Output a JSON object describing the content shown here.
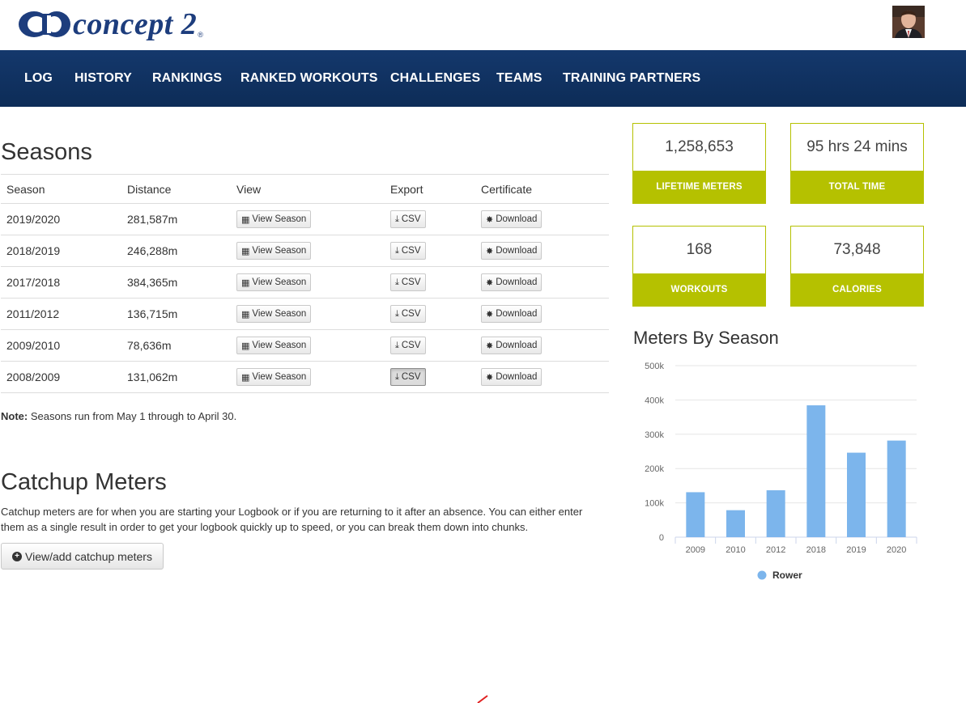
{
  "brand": {
    "name": "concept 2",
    "reg": "®"
  },
  "nav": {
    "items": [
      "LOG",
      "HISTORY",
      "RANKINGS",
      "RANKED WORKOUTS",
      "CHALLENGES",
      "TEAMS",
      "TRAINING PARTNERS"
    ]
  },
  "seasons": {
    "title": "Seasons",
    "columns": [
      "Season",
      "Distance",
      "View",
      "Export",
      "Certificate"
    ],
    "view_label": "View Season",
    "export_label": "CSV",
    "cert_label": "Download",
    "rows": [
      {
        "season": "2019/2020",
        "distance": "281,587m"
      },
      {
        "season": "2018/2019",
        "distance": "246,288m"
      },
      {
        "season": "2017/2018",
        "distance": "384,365m"
      },
      {
        "season": "2011/2012",
        "distance": "136,715m"
      },
      {
        "season": "2009/2010",
        "distance": "78,636m"
      },
      {
        "season": "2008/2009",
        "distance": "131,062m"
      }
    ],
    "note_label": "Note:",
    "note_text": " Seasons run from May 1 through to April 30."
  },
  "catchup": {
    "title": "Catchup Meters",
    "description": "Catchup meters are for when you are starting your Logbook or if you are returning to it after an absence. You can either enter them as a single result in order to get your logbook quickly up to speed, or you can break them down into chunks.",
    "button_label": "View/add catchup meters"
  },
  "stats": {
    "lifetime_meters": {
      "value": "1,258,653",
      "label": "LIFETIME METERS"
    },
    "total_time": {
      "value": "95 hrs 24 mins",
      "label": "TOTAL TIME"
    },
    "workouts": {
      "value": "168",
      "label": "WORKOUTS"
    },
    "calories": {
      "value": "73,848",
      "label": "CALORIES"
    }
  },
  "colors": {
    "accent": "#b5c100",
    "nav": "#14386c",
    "bar": "#7cb5ec",
    "brand": "#1d3d7d"
  },
  "chart_data": {
    "type": "bar",
    "title": "Meters By Season",
    "categories": [
      "2009",
      "2010",
      "2012",
      "2018",
      "2019",
      "2020"
    ],
    "series": [
      {
        "name": "Rower",
        "values": [
          131062,
          78636,
          136715,
          384365,
          246288,
          281587
        ]
      }
    ],
    "ylim": [
      0,
      500000
    ],
    "yticks": [
      "0",
      "100k",
      "200k",
      "300k",
      "400k",
      "500k"
    ],
    "grid": true,
    "legend": "bottom"
  }
}
